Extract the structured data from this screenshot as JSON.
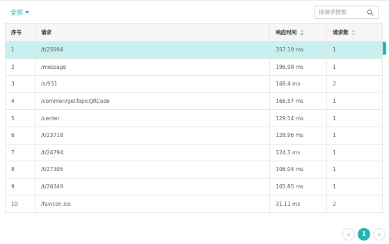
{
  "filter": {
    "label": "全部"
  },
  "search": {
    "placeholder": "按请求搜索"
  },
  "table": {
    "headers": {
      "index": "序号",
      "request": "请求",
      "response_time": "响应时间",
      "request_count": "请求数"
    },
    "rows": [
      {
        "index": "1",
        "request": "/t/25994",
        "response_time": "357.19 ms",
        "request_count": "1"
      },
      {
        "index": "2",
        "request": "/message",
        "response_time": "196.98 ms",
        "request_count": "1"
      },
      {
        "index": "3",
        "request": "/s/931",
        "response_time": "168.4 ms",
        "request_count": "2"
      },
      {
        "index": "4",
        "request": "/common/getTopicQRCode",
        "response_time": "166.57 ms",
        "request_count": "1"
      },
      {
        "index": "5",
        "request": "/center",
        "response_time": "129.14 ms",
        "request_count": "1"
      },
      {
        "index": "6",
        "request": "/t/23718",
        "response_time": "128.96 ms",
        "request_count": "1"
      },
      {
        "index": "7",
        "request": "/t/24794",
        "response_time": "124.3 ms",
        "request_count": "1"
      },
      {
        "index": "8",
        "request": "/t/27305",
        "response_time": "106.04 ms",
        "request_count": "1"
      },
      {
        "index": "9",
        "request": "/t/26349",
        "response_time": "105.85 ms",
        "request_count": "1"
      },
      {
        "index": "10",
        "request": "/favicon.ico",
        "response_time": "31.11 ms",
        "request_count": "2"
      }
    ]
  },
  "pagination": {
    "prev": "«",
    "current": "1",
    "next": "»"
  },
  "colors": {
    "accent": "#26b3b3",
    "active_row": "#c9f0ee"
  },
  "icons": {
    "filter_caret": "caret-down-icon",
    "search": "search-icon",
    "sort": "sort-icon"
  }
}
